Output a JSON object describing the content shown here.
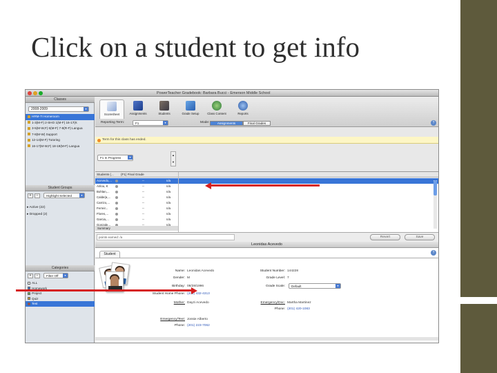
{
  "slide": {
    "title": "Click on a student to get info"
  },
  "window": {
    "title": "PowerTeacher Gradebook: Barbara Bucci - Emerson Middle School"
  },
  "classes": {
    "header": "Classes",
    "year": "2008-2009",
    "items": [
      "HRM-7I Homeroom",
      "1-3(M-F) 2-SHO 1(M-F) 16-17(K",
      "3-5(M-W,F) 6(M-F) 7-8(R-F) Langua",
      "7-8(M-W) Support",
      "12-14(M-F) Tutoring",
      "16-17(M-W,F) 18-19(M-F) Langua"
    ]
  },
  "student_groups": {
    "header": "Student Groups",
    "highlight": "Highlight Selected",
    "items": [
      "Active (22)",
      "Dropped (2)"
    ]
  },
  "categories": {
    "header": "Categories",
    "filter": "Filter Off",
    "items": [
      "ALL",
      "Homework",
      "Project",
      "Quiz",
      "Test"
    ]
  },
  "toolbar": {
    "buttons": [
      "Scoresheet",
      "Assignments",
      "Students",
      "Grade Setup",
      "Class Content",
      "Reports"
    ],
    "reporting_term_label": "Reporting Term:",
    "reporting_term_value": "F1",
    "mode_label": "Mode:",
    "mode_assignments": "Assignments",
    "mode_final": "Final Grades",
    "help": "?"
  },
  "notice": "Term for this class has ended.",
  "grid": {
    "progress_select": "F1 In Progress",
    "col_students": "Students (...",
    "col_final": "(F1) Final Grade",
    "rows": [
      {
        "name": "Acevedo,...",
        "mid": "--",
        "grade": "n/a"
      },
      {
        "name": "Arilou, K",
        "mid": "--",
        "grade": "n/a"
      },
      {
        "name": "Bohlan,...",
        "mid": "--",
        "grade": "n/a"
      },
      {
        "name": "Calde(a,...",
        "mid": "--",
        "grade": "n/a"
      },
      {
        "name": "Carrizo,...",
        "mid": "--",
        "grade": "n/a"
      },
      {
        "name": "Ferreir...",
        "mid": "--",
        "grade": "n/a"
      },
      {
        "name": "Flores,...",
        "mid": "--",
        "grade": "n/a"
      },
      {
        "name": "Garcia,...",
        "mid": "--",
        "grade": "n/a"
      },
      {
        "name": "Gonzale...",
        "mid": "--",
        "grade": "n/a"
      }
    ],
    "summary": "Summary"
  },
  "comment_bar": {
    "placeholder": "points earned: /a",
    "revert": "Revert",
    "save": "Save"
  },
  "student": {
    "display_name": "Leonidas Acevedo",
    "tab": "Student",
    "name_label": "Name:",
    "name_value": "Leonidas Acevedo",
    "gender_label": "Gender:",
    "gender_value": "M",
    "birthday_label": "Birthday:",
    "birthday_value": "08/28/1996",
    "home_phone_label": "Student Home Phone:",
    "home_phone_value": "(201) 432-4313",
    "mother_label": "Mother:",
    "mother_value": "Dayzi Acevedo",
    "emergency_label": "Emergency/Text:",
    "emergency_value": "Jossie Alberto",
    "emergency_phone_label": "Phone:",
    "emergency_phone_value": "(201) 223-7062",
    "student_number_label": "Student Number:",
    "student_number_value": "144228",
    "grade_level_label": "Grade Level:",
    "grade_level_value": "7",
    "grade_scale_label": "Grade Scale:",
    "grade_scale_value": "Default",
    "emergency2_label": "Emergency/Doc:",
    "emergency2_value": "Martha Martinez",
    "phone2_label": "Phone:",
    "phone2_value": "(201) 420-1083"
  }
}
